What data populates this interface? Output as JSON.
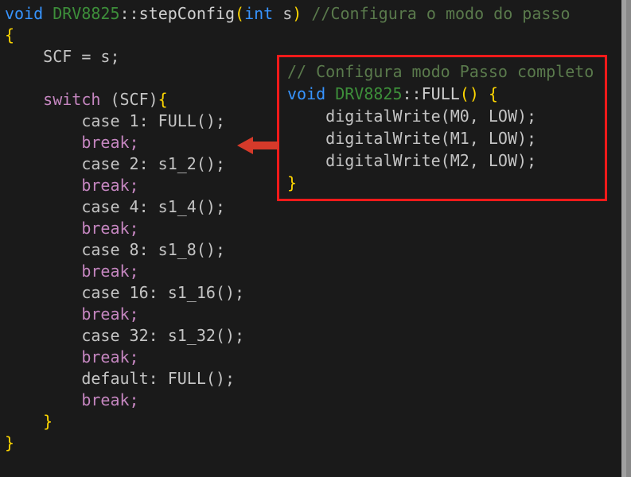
{
  "main": {
    "sig_void": "void",
    "sig_class": "DRV8825",
    "sig_fn": "stepConfig",
    "sig_arg_type": "int",
    "sig_arg_name": "s",
    "sig_comment": "//Configura o modo do passo",
    "assign": "SCF = s;",
    "switch_kw": "switch",
    "switch_var": " (SCF)",
    "cases": {
      "c1": "case 1: FULL();",
      "c2": "case 2: s1_2();",
      "c4": "case 4: s1_4();",
      "c8": "case 8: s1_8();",
      "c16": "case 16: s1_16();",
      "c32": "case 32: s1_32();",
      "def": "default: FULL();"
    },
    "break": "break;"
  },
  "callout": {
    "comment": "// Configura modo Passo completo",
    "sig_void": "void",
    "sig_class": "DRV8825",
    "sig_fn": "FULL",
    "line1": "digitalWrite(M0, LOW);",
    "line2": "digitalWrite(M1, LOW);",
    "line3": "digitalWrite(M2, LOW);"
  }
}
